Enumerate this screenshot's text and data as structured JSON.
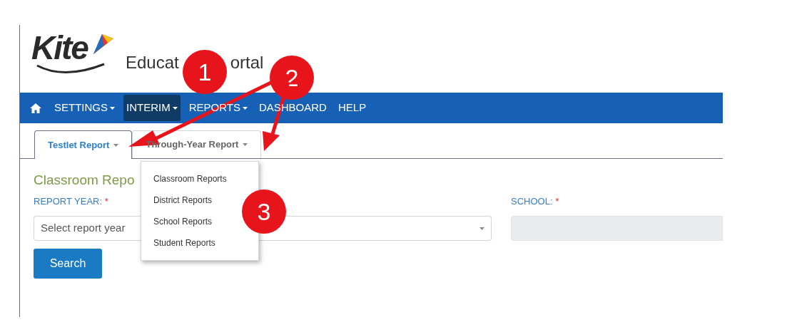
{
  "header": {
    "logo_text": "Kite",
    "title_parts": [
      "Educat",
      "ortal"
    ]
  },
  "nav": [
    {
      "label": "SETTINGS",
      "dropdown": true,
      "selected": false
    },
    {
      "label": "INTERIM",
      "dropdown": true,
      "selected": true
    },
    {
      "label": "REPORTS",
      "dropdown": true,
      "selected": false
    },
    {
      "label": "DASHBOARD",
      "dropdown": false,
      "selected": false
    },
    {
      "label": "HELP",
      "dropdown": false,
      "selected": false
    }
  ],
  "tabs": [
    {
      "label": "Testlet Report",
      "selected": true
    },
    {
      "label": "Through-Year Report",
      "selected": false
    }
  ],
  "dropdown_menu": [
    "Classroom Reports",
    "District Reports",
    "School Reports",
    "Student Reports"
  ],
  "heading": "Classroom Repo",
  "fields": [
    {
      "label": "REPORT YEAR:",
      "required": "*",
      "placeholder": "Select report year",
      "disabled": false
    },
    {
      "label": "SCHOOL:",
      "required": "*",
      "disabled": true
    }
  ],
  "search_button": "Search",
  "callouts": [
    {
      "number": "1"
    },
    {
      "number": "2"
    },
    {
      "number": "3"
    }
  ]
}
